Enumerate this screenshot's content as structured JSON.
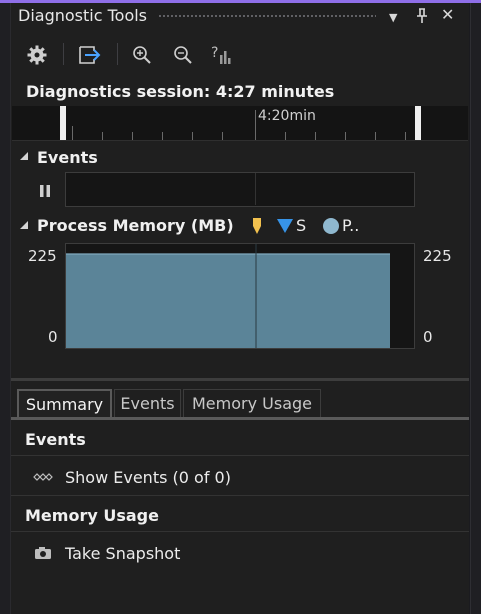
{
  "window": {
    "title": "Diagnostic Tools"
  },
  "title_buttons": {
    "dropdown": "▼",
    "pin": "⊥",
    "close": "✕"
  },
  "toolbar": {
    "settings_icon": "gear-icon",
    "export_icon": "export-icon",
    "zoom_in_icon": "zoom-in-icon",
    "zoom_out_icon": "zoom-out-icon",
    "reset_zoom_icon": "reset-zoom-icon"
  },
  "session": {
    "text": "Diagnostics session: 4:27 minutes"
  },
  "timeline": {
    "marker_label": "4:20min"
  },
  "events_section": {
    "title": "Events",
    "pause_label": "⏸"
  },
  "memory_section": {
    "title": "Process Memory (MB)",
    "legend": [
      {
        "label": "",
        "shape": "pin",
        "color": "#f2c14e"
      },
      {
        "label": "S",
        "shape": "triangle",
        "color": "#3794e8"
      },
      {
        "label": "P..",
        "shape": "circle",
        "color": "#8fb8cf"
      }
    ]
  },
  "chart_data": {
    "type": "area",
    "ylim": [
      0,
      225
    ],
    "yticks_left": [
      "225",
      "0"
    ],
    "yticks_right": [
      "225",
      "0"
    ],
    "series": [
      {
        "values": [
          225,
          225,
          225,
          225,
          225
        ]
      }
    ],
    "fill_color": "#5b8498"
  },
  "tabs": [
    {
      "label": "Summary",
      "active": true
    },
    {
      "label": "Events",
      "active": false
    },
    {
      "label": "Memory Usage",
      "active": false
    }
  ],
  "summary": {
    "events_header": "Events",
    "show_events": "Show Events (0 of 0)",
    "memory_header": "Memory Usage",
    "take_snapshot": "Take Snapshot"
  }
}
